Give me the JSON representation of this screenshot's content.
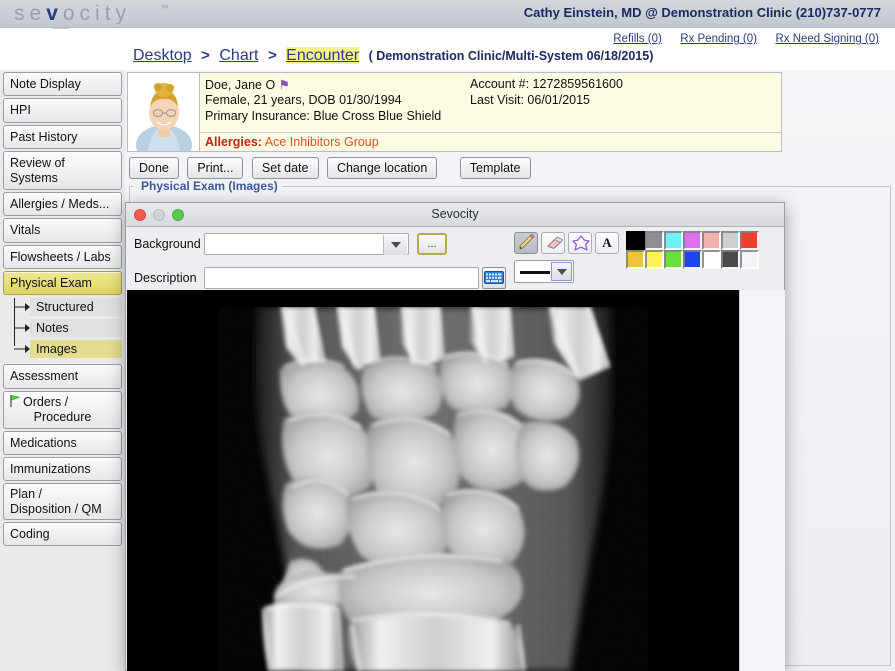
{
  "brand": {
    "name_pre": "se",
    "name_v": "v",
    "name_post": "ocity",
    "tm": "™"
  },
  "header": {
    "provider_line": "Cathy Einstein, MD @ Demonstration Clinic (210)737-0777",
    "links": [
      {
        "label": "Refills (0)",
        "name": "refills-link"
      },
      {
        "label": "Rx Pending (0)",
        "name": "rx-pending-link"
      },
      {
        "label": "Rx Need Signing (0)",
        "name": "rx-need-signing-link"
      }
    ]
  },
  "breadcrumb": {
    "items": [
      "Desktop",
      "Chart",
      "Encounter"
    ],
    "separator": ">",
    "context": "( Demonstration Clinic/Multi-System 06/18/2015)"
  },
  "sidebar": {
    "items": [
      {
        "label": "Note Display",
        "active": false
      },
      {
        "label": "HPI",
        "active": false
      },
      {
        "label": "Past History",
        "active": false
      },
      {
        "label": "Review of Systems",
        "active": false
      },
      {
        "label": "Allergies / Meds...",
        "active": false
      },
      {
        "label": "Vitals",
        "active": false
      },
      {
        "label": "Flowsheets / Labs",
        "active": false
      },
      {
        "label": "Physical Exam",
        "active": true
      }
    ],
    "sub_items": [
      {
        "label": "Structured",
        "active": false
      },
      {
        "label": "Notes",
        "active": false
      },
      {
        "label": "Images",
        "active": true
      }
    ],
    "items_after": [
      {
        "label": "Assessment",
        "active": false,
        "icon": ""
      },
      {
        "label": "Orders /\nProcedure",
        "active": false,
        "icon": "green-flag-icon"
      },
      {
        "label": "Medications",
        "active": false,
        "icon": ""
      },
      {
        "label": "Immunizations",
        "active": false,
        "icon": ""
      },
      {
        "label": "Plan /\nDisposition / QM",
        "active": false,
        "icon": ""
      },
      {
        "label": "Coding",
        "active": false,
        "icon": ""
      }
    ]
  },
  "patient": {
    "name": "Doe, Jane O",
    "flag": "⚑",
    "demographics": "Female, 21 years, DOB 01/30/1994",
    "insurance": "Primary Insurance: Blue Cross Blue Shield",
    "account_label": "Account #: 1272859561600",
    "last_visit_label": "Last Visit: 06/01/2015",
    "allergies_label": "Allergies:",
    "allergies_value": "Ace Inhibitors Group"
  },
  "toolbar": {
    "buttons": [
      {
        "label": "Done"
      },
      {
        "label": "Print..."
      },
      {
        "label": "Set date"
      },
      {
        "label": "Change location"
      },
      {
        "label": "Template"
      }
    ]
  },
  "section": {
    "legend": "Physical Exam (Images)"
  },
  "dialog": {
    "title": "Sevocity",
    "traffic": {
      "close": "#f45a4e",
      "minimize": "#cfd2d6",
      "maximize": "#58cc4b"
    },
    "background_label": "Background",
    "background_value": "",
    "background_placeholder": "",
    "browse_label": "...",
    "description_label": "Description",
    "description_value": "",
    "description_placeholder": "",
    "keyboard_icon": "keyboard-icon",
    "tools": [
      {
        "name": "pencil-tool",
        "glyph": "pencil-icon",
        "selected": true
      },
      {
        "name": "eraser-tool",
        "glyph": "eraser-icon",
        "selected": false
      },
      {
        "name": "shape-tool",
        "glyph": "polygon-star-icon",
        "selected": false
      },
      {
        "name": "text-tool",
        "glyph": "A",
        "selected": false
      }
    ],
    "line_width": {
      "name": "line-width-select",
      "preview": "solid-thick"
    },
    "palette": {
      "row1": [
        "#000000",
        "#8c8f94",
        "#6ff0f5",
        "#e06ef0",
        "#f2b0b0",
        "#cfcfcf",
        "#e8412e"
      ],
      "row2": [
        "#f0c33c",
        "#fbf158",
        "#69e03a",
        "#1f44f0",
        "#ffffff",
        "#4a4a4a",
        "#f2f4f8"
      ],
      "selected_index": 0
    },
    "canvas": {
      "label": "xray-image",
      "alt": "Hand / wrist radiograph"
    }
  }
}
